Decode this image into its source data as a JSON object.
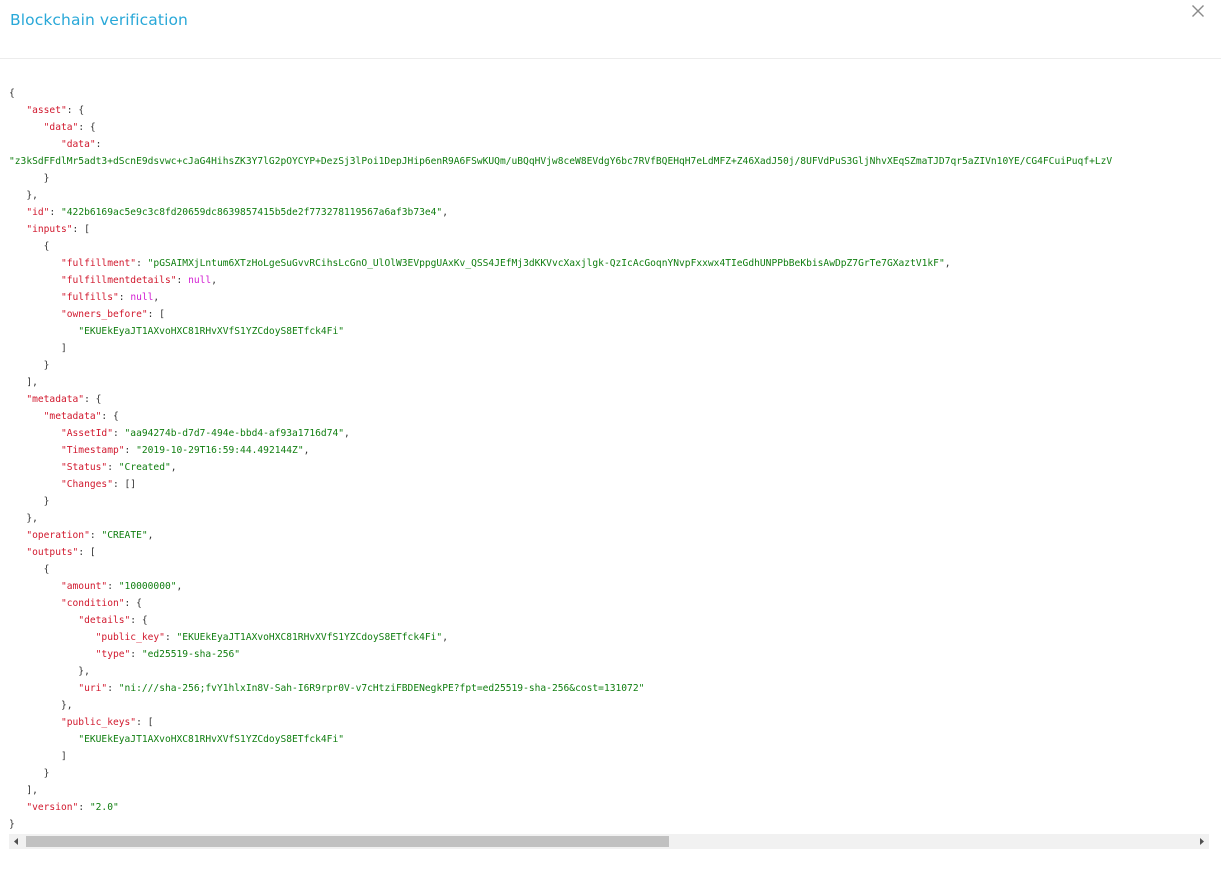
{
  "dialog": {
    "title": "Blockchain verification",
    "close_icon": "close-icon"
  },
  "colors": {
    "title": "#29a8d8",
    "key": "#d1192e",
    "string": "#107e10",
    "null": "#d21ed2"
  },
  "json": {
    "asset_key": "\"asset\"",
    "asset_data_key": "\"data\"",
    "asset_data_data_key": "\"data\"",
    "asset_data_data_value": "\"z3kSdFFdlMr5adt3+dScnE9dsvwc+cJaG4HihsZK3Y7lG2pOYCYP+DezSj3lPoi1DepJHip6enR9A6FSwKUQm/uBQqHVjw8ceW8EVdgY6bc7RVfBQEHqH7eLdMFZ+Z46XadJ50j/8UFVdPuS3GljNhvXEqSZmaTJD7qr5aZIVn10YE/CG4FCuiPuqf+LzV",
    "id_key": "\"id\"",
    "id_value": "\"422b6169ac5e9c3c8fd20659dc8639857415b5de2f773278119567a6af3b73e4\"",
    "inputs_key": "\"inputs\"",
    "fulfillment_key": "\"fulfillment\"",
    "fulfillment_value": "\"pGSAIMXjLntum6XTzHoLgeSuGvvRCihsLcGnO_UlOlW3EVppgUAxKv_QSS4JEfMj3dKKVvcXaxjlgk-QzIcAcGoqnYNvpFxxwx4TIeGdhUNPPbBeKbisAwDpZ7GrTe7GXaztV1kF\"",
    "fulfillmentdetails_key": "\"fulfillmentdetails\"",
    "fulfills_key": "\"fulfills\"",
    "null_value": "null",
    "owners_before_key": "\"owners_before\"",
    "owner_value": "\"EKUEkEyaJT1AXvoHXC81RHvXVfS1YZCdoyS8ETfck4Fi\"",
    "metadata_key": "\"metadata\"",
    "metadata_inner_key": "\"metadata\"",
    "assetid_key": "\"AssetId\"",
    "assetid_value": "\"aa94274b-d7d7-494e-bbd4-af93a1716d74\"",
    "timestamp_key": "\"Timestamp\"",
    "timestamp_value": "\"2019-10-29T16:59:44.492144Z\"",
    "status_key": "\"Status\"",
    "status_value": "\"Created\"",
    "changes_key": "\"Changes\"",
    "changes_value": "[]",
    "operation_key": "\"operation\"",
    "operation_value": "\"CREATE\"",
    "outputs_key": "\"outputs\"",
    "amount_key": "\"amount\"",
    "amount_value": "\"10000000\"",
    "condition_key": "\"condition\"",
    "details_key": "\"details\"",
    "public_key_key": "\"public_key\"",
    "public_key_value": "\"EKUEkEyaJT1AXvoHXC81RHvXVfS1YZCdoyS8ETfck4Fi\"",
    "type_key": "\"type\"",
    "type_value": "\"ed25519-sha-256\"",
    "uri_key": "\"uri\"",
    "uri_value": "\"ni:///sha-256;fvY1hlxIn8V-Sah-I6R9rpr0V-v7cHtziFBDENegkPE?fpt=ed25519-sha-256&cost=131072\"",
    "public_keys_key": "\"public_keys\"",
    "public_keys_item": "\"EKUEkEyaJT1AXvoHXC81RHvXVfS1YZCdoyS8ETfck4Fi\"",
    "version_key": "\"version\"",
    "version_value": "\"2.0\""
  },
  "scrollbar": {
    "left_arrow_icon": "triangle-left-icon",
    "right_arrow_icon": "triangle-right-icon",
    "scroll_fraction_visible": 0.54
  }
}
